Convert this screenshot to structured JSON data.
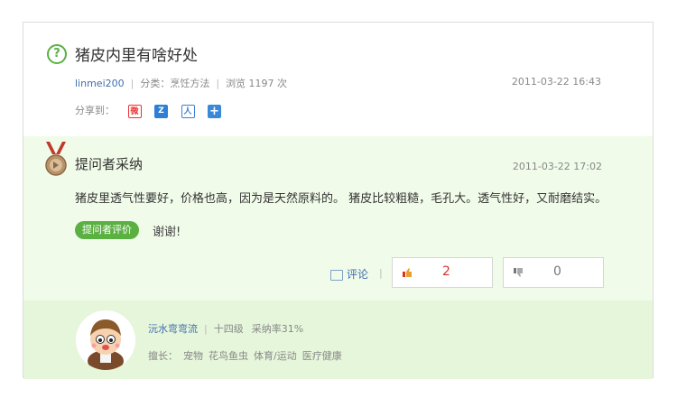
{
  "question": {
    "title": "猪皮内里有啥好处",
    "user": "linmei200",
    "category": "分类：烹饪方法",
    "views": "浏览 1197 次",
    "time": "2011-03-22 16:43",
    "share_label": "分享到：",
    "share_icons": [
      "weibo-icon",
      "qzone-icon",
      "renren-icon",
      "more-share-icon"
    ]
  },
  "answer": {
    "heading": "提问者采纳",
    "time": "2011-03-22 17:02",
    "text": "猪皮里透气性要好，价格也高，因为是天然原料的。 猪皮比较粗糙，毛孔大。透气性好，又耐磨结实。",
    "badge": "提问者评价",
    "thanks": "谢谢!",
    "comment_label": "评论",
    "upvotes": "2",
    "downvotes": "0"
  },
  "profile": {
    "name": "沅水弯弯流",
    "level": "十四级",
    "adopt_rate": "采纳率31%",
    "skills_label": "擅长：",
    "skills": [
      "宠物",
      "花鸟鱼虫",
      "体育/运动",
      "医疗健康"
    ]
  },
  "colors": {
    "accent_green": "#5bb042",
    "link_blue": "#3f6fb0",
    "answer_bg": "#f1fbe9",
    "profile_bg": "#e6f6da",
    "vote_red": "#d9322b"
  }
}
